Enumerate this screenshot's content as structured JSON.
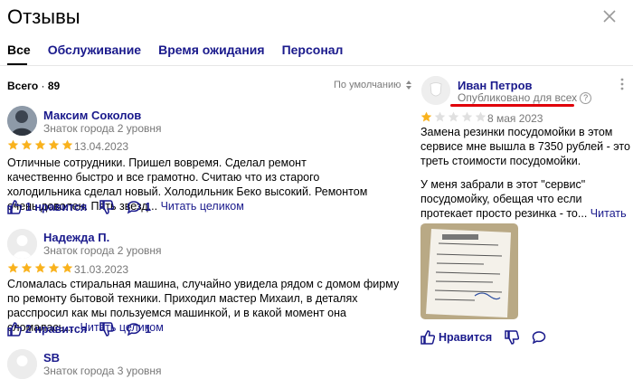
{
  "header": {
    "title": "Отзывы"
  },
  "tabs": [
    {
      "label": "Все"
    },
    {
      "label": "Обслуживание"
    },
    {
      "label": "Время ожидания"
    },
    {
      "label": "Персонал"
    }
  ],
  "summary": {
    "total_label": "Всего",
    "total_count": "89",
    "sort_label": "По умолчанию"
  },
  "reviews": [
    {
      "name": "Максим Соколов",
      "level": "Знаток города 2 уровня",
      "rating": 5,
      "date": "13.04.2023",
      "text": "Отличные сотрудники. Пришел вовремя. Сделал ремонт качественно быстро и все грамотно. Считаю что из старого холодильника сделал новый. Холодильник Беко высокий. Ремонтом очень доволен. Пять звезд...",
      "more": "Читать целиком",
      "likes": "1 нравится",
      "comments": "1"
    },
    {
      "name": "Надежда П.",
      "level": "Знаток города 2 уровня",
      "rating": 5,
      "date": "31.03.2023",
      "text": "Сломалась стиральная машина, случайно увидела рядом с домом фирму по ремонту бытовой техники. Приходил мастер Михаил, в деталях расспросил как мы пользуемся машинкой, и в какой момент она сломалась....",
      "more": "Читать целиком",
      "likes": "2 нравится",
      "comments": "1"
    },
    {
      "name": "SB",
      "level": "Знаток города 3 уровня"
    }
  ],
  "featured": {
    "name": "Иван Петров",
    "status": "Опубликовано для всех",
    "status_help": "?",
    "rating": 1,
    "date": "8 мая 2023",
    "text1": "Замена резинки посудомойки в этом сервисе мне вышла в 7350 рублей - это треть стоимости посудомойки.",
    "text2": "У меня забрали в этот \"сервис\" посудомойку, обещая что если протекает просто резинка - то...",
    "more": "Читать целиком",
    "like_label": "Нравится",
    "colors": {
      "highlight": "#e0000a"
    }
  },
  "colors": {
    "star": "#f9b21d",
    "star_empty": "#e0e0e0",
    "link": "#1a1a8c"
  }
}
